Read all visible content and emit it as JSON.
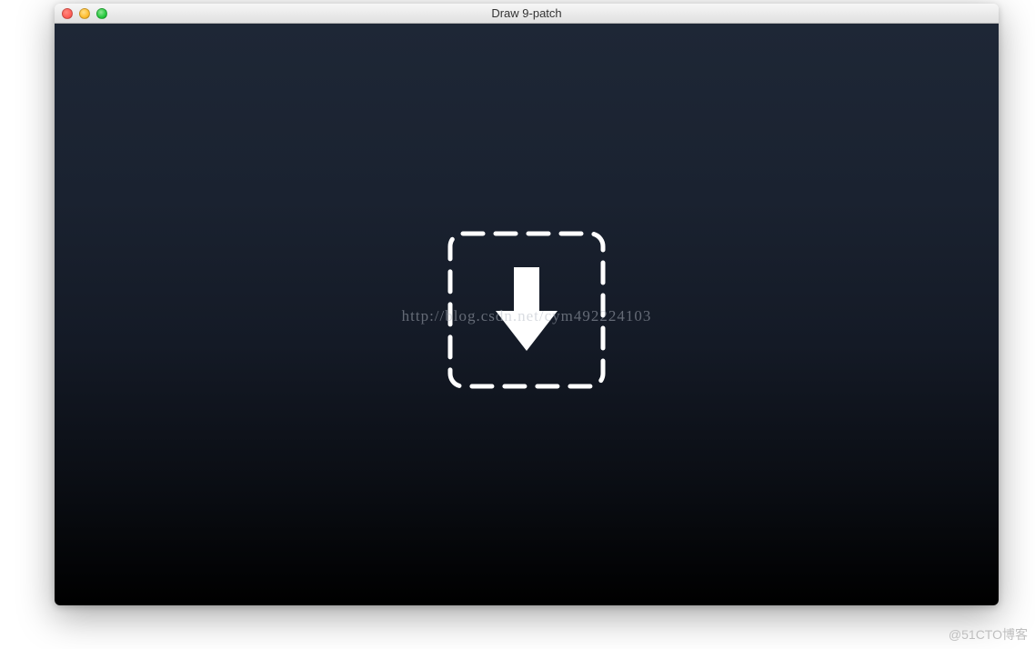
{
  "window": {
    "title": "Draw 9-patch"
  },
  "dropzone": {
    "icon_name": "download-arrow-icon"
  },
  "watermarks": {
    "center": "http://blog.csdn.net/cym492224103",
    "corner": "@51CTO博客"
  },
  "colors": {
    "dashed_border": "#ffffff",
    "arrow_fill": "#ffffff"
  }
}
